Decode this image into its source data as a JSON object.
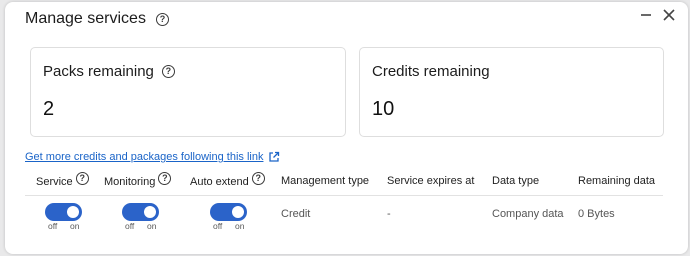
{
  "dialog": {
    "title": "Manage services"
  },
  "cards": {
    "packs": {
      "label": "Packs remaining",
      "value": "2"
    },
    "credits": {
      "label": "Credits remaining",
      "value": "10"
    }
  },
  "link": {
    "text": "Get more credits and packages following this link"
  },
  "table": {
    "headers": {
      "service": "Service",
      "monitoring": "Monitoring",
      "auto_extend": "Auto extend",
      "management_type": "Management type",
      "service_expires": "Service expires at",
      "data_type": "Data type",
      "remaining_data": "Remaining data"
    },
    "row": {
      "service": {
        "off": "off",
        "on": "on",
        "state": "on"
      },
      "monitoring": {
        "off": "off",
        "on": "on",
        "state": "on"
      },
      "auto_extend": {
        "off": "off",
        "on": "on",
        "state": "on"
      },
      "management_type": "Credit",
      "service_expires": "-",
      "data_type": "Company data",
      "remaining_data": "0 Bytes"
    }
  },
  "icons": {
    "help": "question-circle-icon",
    "minimize": "minimize-icon",
    "close": "close-icon",
    "external": "external-link-icon"
  },
  "colors": {
    "toggle_on": "#2b63c9",
    "link": "#1a64c8"
  }
}
